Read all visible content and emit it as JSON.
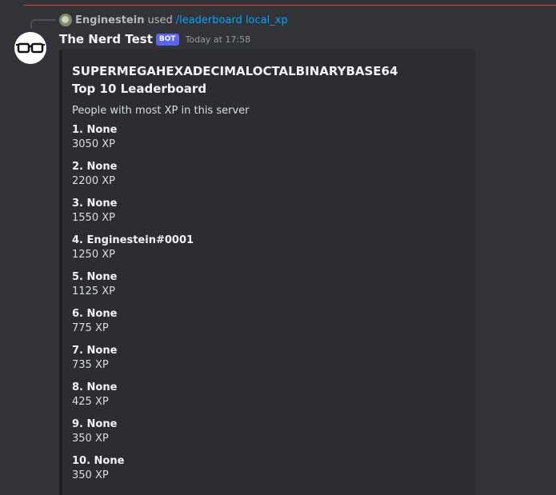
{
  "reply": {
    "user": "Enginestein",
    "used": "used",
    "command": "/leaderboard local_xp"
  },
  "message": {
    "author": "The Nerd Test",
    "badge": "BOT",
    "timestamp": "Today at 17:58"
  },
  "embed": {
    "title": "SUPERMEGAHEXADECIMALOCTALBINARYBASE64 Top 10 Leaderboard",
    "description": "People with most XP in this server",
    "entries": [
      {
        "name": "1. None",
        "xp": "3050 XP"
      },
      {
        "name": "2. None",
        "xp": "2200 XP"
      },
      {
        "name": "3. None",
        "xp": "1550 XP"
      },
      {
        "name": "4. Enginestein#0001",
        "xp": "1250 XP"
      },
      {
        "name": "5. None",
        "xp": "1125 XP"
      },
      {
        "name": "6. None",
        "xp": "775 XP"
      },
      {
        "name": "7. None",
        "xp": "735 XP"
      },
      {
        "name": "8. None",
        "xp": "425 XP"
      },
      {
        "name": "9. None",
        "xp": "350 XP"
      },
      {
        "name": "10. None",
        "xp": "350 XP"
      }
    ]
  },
  "colors": {
    "background": "#313338",
    "embed_bg": "#2b2d31",
    "link": "#00a8fc",
    "bot_badge": "#5865f2",
    "new_messages_line": "#f23f43"
  },
  "icons": {
    "avatar": "glasses-icon",
    "reply_avatar": "user-avatar-icon"
  }
}
